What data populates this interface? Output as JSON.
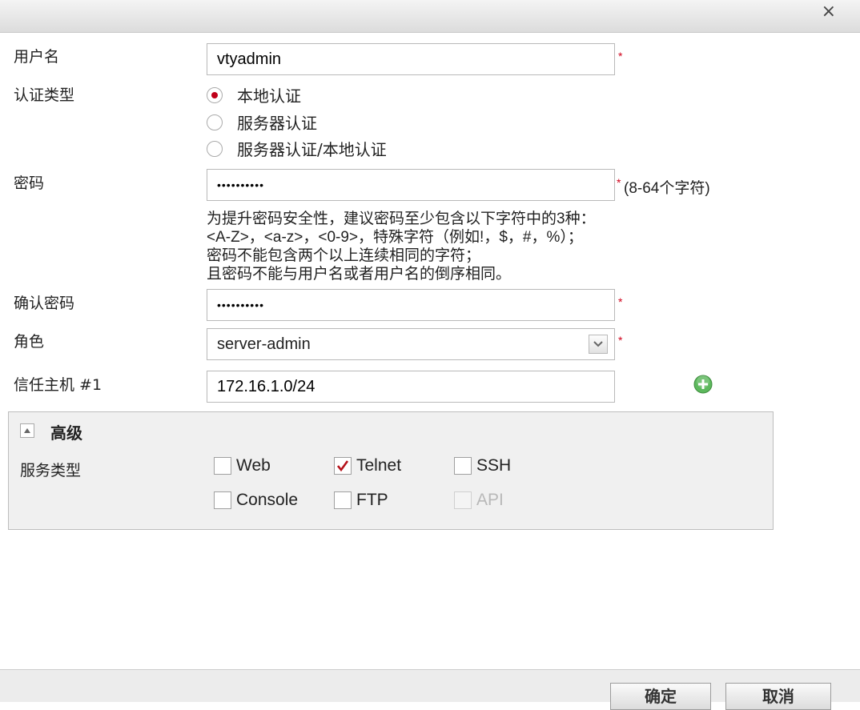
{
  "dialog": {
    "close_glyph": "×"
  },
  "form": {
    "username": {
      "label": "用户名",
      "value": "vtyadmin",
      "required_mark": "*"
    },
    "auth_type": {
      "label": "认证类型",
      "options": [
        {
          "label": "本地认证",
          "selected": true
        },
        {
          "label": "服务器认证",
          "selected": false
        },
        {
          "label": "服务器认证/本地认证",
          "selected": false
        }
      ]
    },
    "password": {
      "label": "密码",
      "value": "••••••••••",
      "required_mark": "*",
      "length_hint": "(8-64个字符)",
      "hint_lines": [
        "为提升密码安全性，建议密码至少包含以下字符中的3种：",
        "<A-Z>，<a-z>，<0-9>，特殊字符（例如!，$，#，%）；",
        "密码不能包含两个以上连续相同的字符；",
        "且密码不能与用户名或者用户名的倒序相同。"
      ]
    },
    "confirm_password": {
      "label": "确认密码",
      "value": "••••••••••",
      "required_mark": "*"
    },
    "role": {
      "label": "角色",
      "value": "server-admin",
      "required_mark": "*"
    },
    "trusted_host": {
      "label": "信任主机 #1",
      "value": "172.16.1.0/24"
    }
  },
  "advanced": {
    "title": "高级",
    "service_label": "服务类型",
    "services": [
      {
        "label": "Web",
        "checked": false,
        "disabled": false
      },
      {
        "label": "Telnet",
        "checked": true,
        "disabled": false
      },
      {
        "label": "SSH",
        "checked": false,
        "disabled": false
      },
      {
        "label": "Console",
        "checked": false,
        "disabled": false
      },
      {
        "label": "FTP",
        "checked": false,
        "disabled": false
      },
      {
        "label": "API",
        "checked": false,
        "disabled": true
      }
    ]
  },
  "buttons": {
    "ok": "确定",
    "cancel": "取消"
  },
  "colors": {
    "required": "#d0021b",
    "radio_selected": "#c0001a",
    "check": "#b5121b",
    "add_icon": "#4caf50"
  }
}
